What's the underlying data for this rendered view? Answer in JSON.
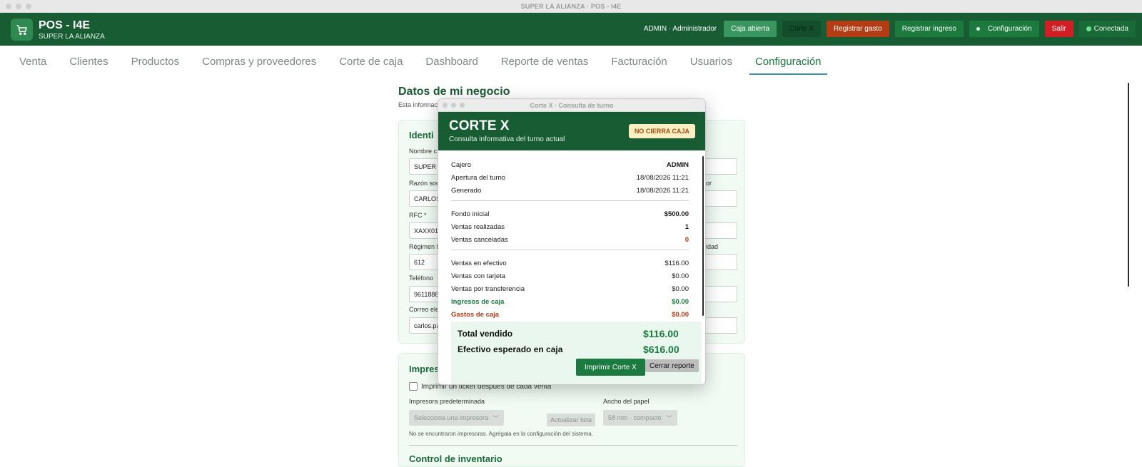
{
  "window": {
    "title": "SUPER LA ALIANZA · POS - I4E"
  },
  "header": {
    "app_name": "POS - I4E",
    "store_name": "SUPER LA ALIANZA",
    "user_label": "ADMIN · Administrador",
    "buttons": {
      "caja_abierta": "Caja abierta",
      "corte_x": "Corte X",
      "registrar_gasto": "Registrar gasto",
      "registrar_ingreso": "Registrar ingreso",
      "configuracion": "Configuración",
      "salir": "Salir",
      "conectada": "Conectada"
    }
  },
  "tabs": [
    "Venta",
    "Clientes",
    "Productos",
    "Compras y proveedores",
    "Corte de caja",
    "Dashboard",
    "Reporte de ventas",
    "Facturación",
    "Usuarios",
    "Configuración"
  ],
  "active_tab": "Configuración",
  "page": {
    "title": "Datos de mi negocio",
    "subtitle": "Esta informac",
    "section1_title": "Identi",
    "fields": [
      {
        "label": "Nombre c",
        "value": "SUPER L"
      },
      {
        "label": "Razón soc",
        "value": "CARLOS"
      },
      {
        "label": "RFC *",
        "value": "XAXX010"
      },
      {
        "label": "Régimen f",
        "value": "612"
      },
      {
        "label": "Teléfono",
        "value": "96118884"
      },
      {
        "label": "Correo ele",
        "value": "carlos.pa"
      }
    ],
    "right_labels": {
      "r2": "or",
      "r4": "idad"
    },
    "section2_title": "Impres",
    "print_checkbox_label": "Imprimir un ticket después de cada venta",
    "printer_label": "Impresora predeterminada",
    "printer_select": "Selecciona una impresora",
    "refresh_button": "Actualizar lista",
    "paper_label": "Ancho del papel",
    "paper_select": "58 mm · compacto",
    "no_printers_note": "No se encontraron impresoras. Agrégala en la configuración del sistema.",
    "section3_title": "Control de inventario"
  },
  "modal": {
    "window_title": "Corte X · Consulta de turno",
    "title": "CORTE X",
    "subtitle": "Consulta informativa del turno actual",
    "badge": "NO CIERRA CAJA",
    "rows": {
      "cajero": {
        "label": "Cajero",
        "value": "ADMIN"
      },
      "apertura": {
        "label": "Apertura del turno",
        "value": "18/08/2026 11:21"
      },
      "generado": {
        "label": "Generado",
        "value": "18/08/2026 11:21"
      },
      "fondo": {
        "label": "Fondo inicial",
        "value": "$500.00"
      },
      "ventas_realizadas": {
        "label": "Ventas realizadas",
        "value": "1"
      },
      "ventas_canceladas": {
        "label": "Ventas canceladas",
        "value": "0"
      },
      "efectivo": {
        "label": "Ventas en efectivo",
        "value": "$116.00"
      },
      "tarjeta": {
        "label": "Ventas con tarjeta",
        "value": "$0.00"
      },
      "transferencia": {
        "label": "Ventas por transferencia",
        "value": "$0.00"
      },
      "ingresos": {
        "label": "Ingresos de caja",
        "value": "$0.00"
      },
      "gastos": {
        "label": "Gastos de caja",
        "value": "$0.00"
      }
    },
    "total_vendido_label": "Total vendido",
    "total_vendido_value": "$116.00",
    "efectivo_esperado_label": "Efectivo esperado en caja",
    "efectivo_esperado_value": "$616.00",
    "print_button": "Imprimir Corte X",
    "close_button": "Cerrar reporte"
  },
  "colors": {
    "brand_green": "#175c33",
    "accent_green": "#1a7a3f",
    "danger_red": "#d21f26",
    "expense_orange": "#b23c14",
    "badge_bg": "#fcefc4"
  }
}
